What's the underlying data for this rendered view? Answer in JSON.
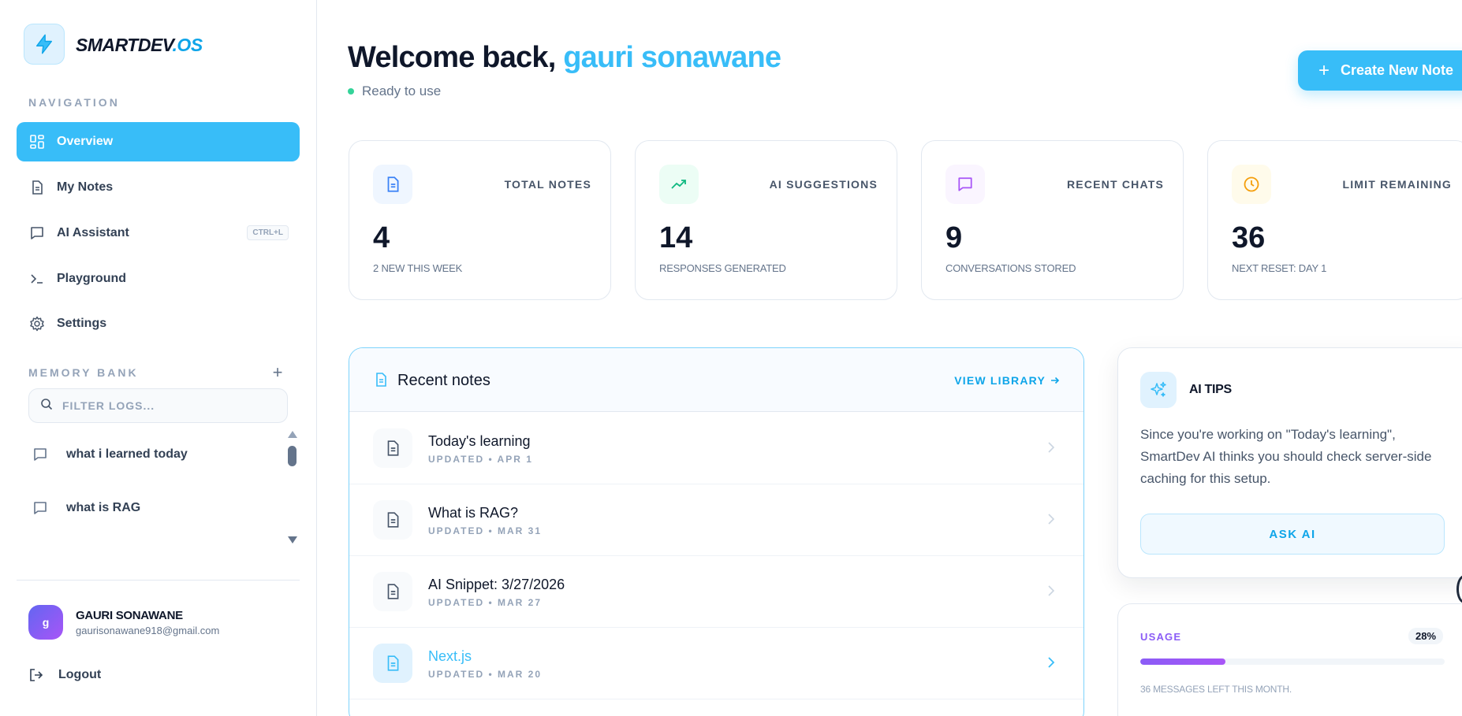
{
  "brand": {
    "name_main": "SMARTDEV",
    "name_accent": ".OS",
    "accent_color": "#38bdf8"
  },
  "sidebar": {
    "nav_label": "NAVIGATION",
    "items": [
      {
        "label": "Overview",
        "icon": "grid-icon",
        "active": true
      },
      {
        "label": "My Notes",
        "icon": "document-icon"
      },
      {
        "label": "AI Assistant",
        "icon": "chat-icon",
        "shortcut": "CTRL+L"
      },
      {
        "label": "Playground",
        "icon": "terminal-icon"
      },
      {
        "label": "Settings",
        "icon": "gear-icon"
      }
    ],
    "memory_label": "MEMORY BANK",
    "filter_placeholder": "FILTER LOGS...",
    "memory_items": [
      {
        "label": "what i learned today"
      },
      {
        "label": "what is RAG"
      }
    ],
    "user": {
      "initial": "g",
      "name": "GAURI SONAWANE",
      "email": "gaurisonawane918@gmail.com"
    },
    "logout_label": "Logout"
  },
  "header": {
    "greeting": "Welcome back, ",
    "user_name": "gauri sonawane",
    "status": "Ready to use",
    "create_button": "Create New Note"
  },
  "stats": [
    {
      "label": "TOTAL NOTES",
      "value": "4",
      "sub": "2 NEW THIS WEEK",
      "icon": "document-icon",
      "color": "#3b82f6",
      "bg": "#eff6ff"
    },
    {
      "label": "AI SUGGESTIONS",
      "value": "14",
      "sub": "RESPONSES GENERATED",
      "icon": "trending-up-icon",
      "color": "#10b981",
      "bg": "#ecfdf5"
    },
    {
      "label": "RECENT CHATS",
      "value": "9",
      "sub": "CONVERSATIONS STORED",
      "icon": "chat-icon",
      "color": "#a855f7",
      "bg": "#faf5ff"
    },
    {
      "label": "LIMIT REMAINING",
      "value": "36",
      "sub": "NEXT RESET: DAY 1",
      "icon": "clock-icon",
      "color": "#f59e0b",
      "bg": "#fffbeb"
    }
  ],
  "recent_notes": {
    "title": "Recent notes",
    "view_library": "VIEW LIBRARY",
    "items": [
      {
        "title": "Today's learning",
        "updated": "UPDATED • APR 1"
      },
      {
        "title": "What is RAG?",
        "updated": "UPDATED • MAR 31"
      },
      {
        "title": "AI Snippet: 3/27/2026",
        "updated": "UPDATED • MAR 27"
      },
      {
        "title": "Next.js",
        "updated": "UPDATED • MAR 20",
        "highlighted": true
      }
    ]
  },
  "tips": {
    "title": "AI TIPS",
    "body": "Since you're working on \"Today's learning\", SmartDev AI thinks you should check server-side caching for this setup.",
    "button": "ASK AI"
  },
  "usage": {
    "title": "USAGE",
    "percent_label": "28%",
    "percent": 28,
    "message": "36 MESSAGES LEFT THIS MONTH."
  }
}
